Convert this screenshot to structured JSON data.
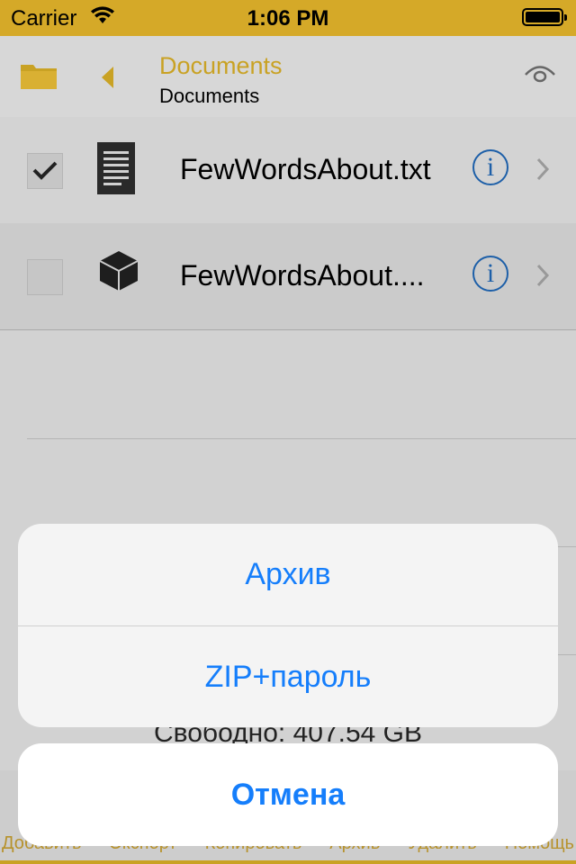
{
  "status_bar": {
    "carrier": "Carrier",
    "time": "1:06 PM"
  },
  "nav": {
    "title": "Documents",
    "subtitle": "Documents",
    "accent_color": "#c9a224"
  },
  "files": [
    {
      "name": "FewWordsAbout.txt",
      "checked": true,
      "icon": "text-document-icon"
    },
    {
      "name": "FewWordsAbout....",
      "checked": false,
      "icon": "box-archive-icon"
    }
  ],
  "free_space": "Свободно: 407.54 GB",
  "toolbar": {
    "items": [
      "Добавить",
      "Экспорт",
      "Копировать",
      "Архив",
      "Удалить",
      "Помощь"
    ]
  },
  "action_sheet": {
    "archive_label": "Архив",
    "zip_password_label": "ZIP+пароль",
    "cancel_label": "Отмена",
    "button_color": "#157efb"
  }
}
